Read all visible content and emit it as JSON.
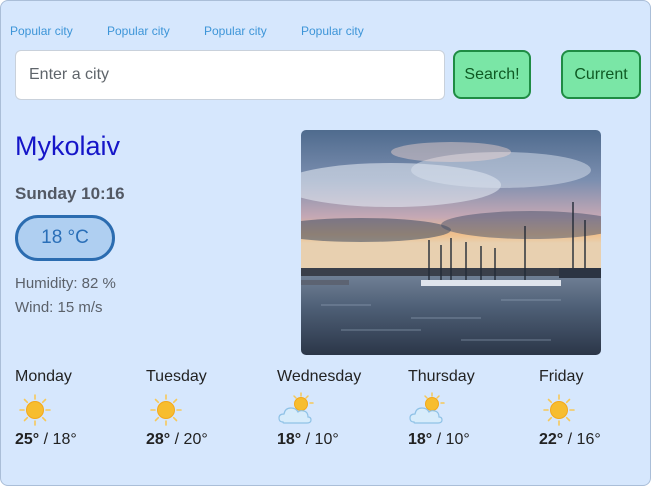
{
  "popular_cities": [
    "Popular city",
    "Popular city",
    "Popular city",
    "Popular city"
  ],
  "search": {
    "placeholder": "Enter a city",
    "value": ""
  },
  "buttons": {
    "search": "Search!",
    "current": "Current"
  },
  "current": {
    "city": "Mykolaiv",
    "datetime": "Sunday 10:16",
    "temperature": "18 °C",
    "humidity": "Humidity: 82 %",
    "wind": "Wind: 15 m/s",
    "photo": "sunset-harbor-photo"
  },
  "forecast": [
    {
      "day": "Monday",
      "icon": "sunny-icon",
      "high": "25°",
      "low": "18°"
    },
    {
      "day": "Tuesday",
      "icon": "sunny-icon",
      "high": "28°",
      "low": "20°"
    },
    {
      "day": "Wednesday",
      "icon": "partly-cloudy-icon",
      "high": "18°",
      "low": "10°"
    },
    {
      "day": "Thursday",
      "icon": "partly-cloudy-icon",
      "high": "18°",
      "low": "10°"
    },
    {
      "day": "Friday",
      "icon": "sunny-icon",
      "high": "22°",
      "low": "16°"
    }
  ],
  "colors": {
    "accent_green": "#7ae6a6",
    "city_blue": "#1515c8",
    "background": "#d6e7fd"
  }
}
